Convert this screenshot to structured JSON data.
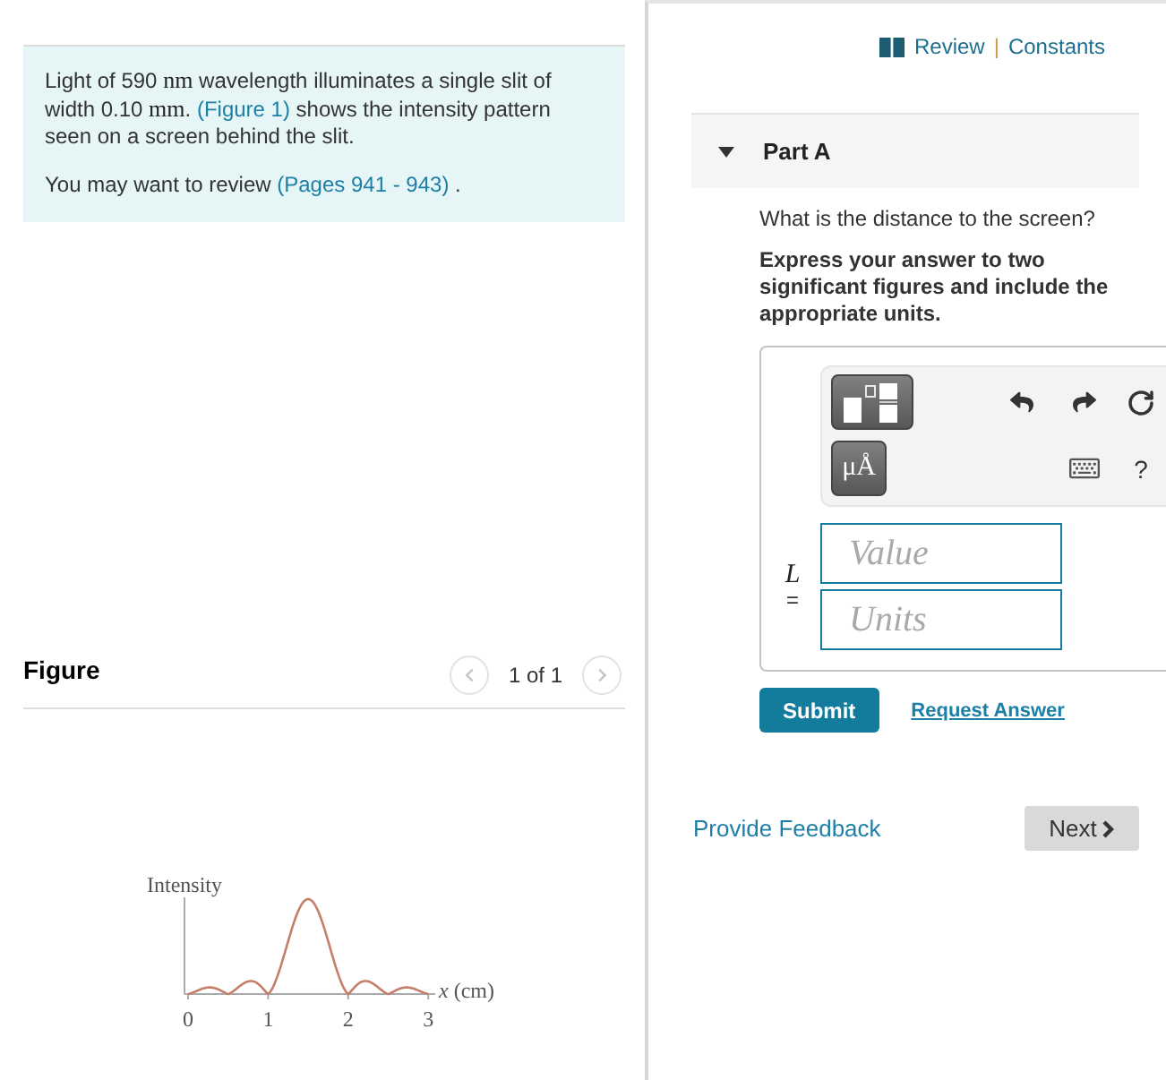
{
  "problem": {
    "intro": [
      {
        "kind": "text",
        "text": "Light of 590 "
      },
      {
        "kind": "unit",
        "text": "nm"
      },
      {
        "kind": "text",
        "text": " wavelength illuminates a single slit of width 0.10 "
      },
      {
        "kind": "unit",
        "text": "mm"
      },
      {
        "kind": "text",
        "text": ". "
      },
      {
        "kind": "link",
        "text": "(Figure 1)"
      },
      {
        "kind": "text",
        "text": " shows the intensity pattern seen on a screen behind the slit."
      }
    ],
    "review": [
      {
        "kind": "text",
        "text": "You may want to review "
      },
      {
        "kind": "link",
        "text": "(Pages 941 - 943)"
      },
      {
        "kind": "text",
        "text": " ."
      }
    ]
  },
  "figure_panel": {
    "title": "Figure",
    "pager": {
      "label": "1 of 1",
      "prev": {
        "disabled": true
      },
      "next": {
        "disabled": true
      }
    },
    "plot": {
      "y_label": "Intensity",
      "x_label": "*x* (cm)",
      "x_ticks": [
        "0",
        "1",
        "2",
        "3"
      ]
    }
  },
  "header_links": {
    "items": [
      {
        "label": "Review"
      },
      {
        "label": "Constants"
      }
    ],
    "separator": "|"
  },
  "part": {
    "title": "Part A",
    "expanded": true,
    "question": "What is the distance to the screen?",
    "instructions": "Express your answer to two significant figures and include the appropriate units.",
    "answer": {
      "variable": "L",
      "equals": "=",
      "toolbar": {
        "units_button": "μÅ",
        "help": "?"
      },
      "value": {
        "placeholder": "Value"
      },
      "units": {
        "placeholder": "Units"
      }
    },
    "submit": "Submit",
    "request_answer": "Request Answer"
  },
  "footer": {
    "feedback": "Provide Feedback",
    "next": "Next"
  }
}
